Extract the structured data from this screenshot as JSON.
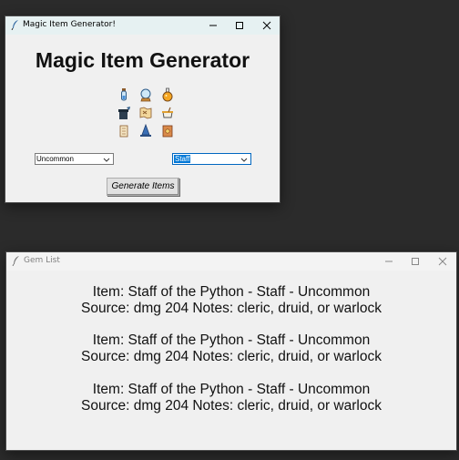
{
  "generator_window": {
    "title": "Magic Item Generator!",
    "heading": "Magic Item Generator",
    "icons": [
      "potion-vial-icon",
      "crystal-ball-icon",
      "flask-icon",
      "hat-scroll-icon",
      "map-icon",
      "cauldron-icon",
      "scroll-icon",
      "wizard-hat-icon",
      "spellbook-icon"
    ],
    "rarity_select": {
      "value": "Uncommon"
    },
    "type_select": {
      "value": "Staff"
    },
    "generate_button": "Generate Items"
  },
  "gem_window": {
    "title": "Gem List",
    "entries": [
      {
        "line1": "Item: Staff of the Python - Staff - Uncommon",
        "line2": "Source: dmg 204 Notes: cleric, druid, or warlock"
      },
      {
        "line1": "Item: Staff of the Python - Staff - Uncommon",
        "line2": "Source: dmg 204 Notes: cleric, druid, or warlock"
      },
      {
        "line1": "Item: Staff of the Python - Staff - Uncommon",
        "line2": "Source: dmg 204 Notes: cleric, druid, or warlock"
      }
    ]
  },
  "colors": {
    "desktop": "#2b2b2b",
    "window_bg": "#f0f0f0",
    "selection": "#0078d7"
  }
}
